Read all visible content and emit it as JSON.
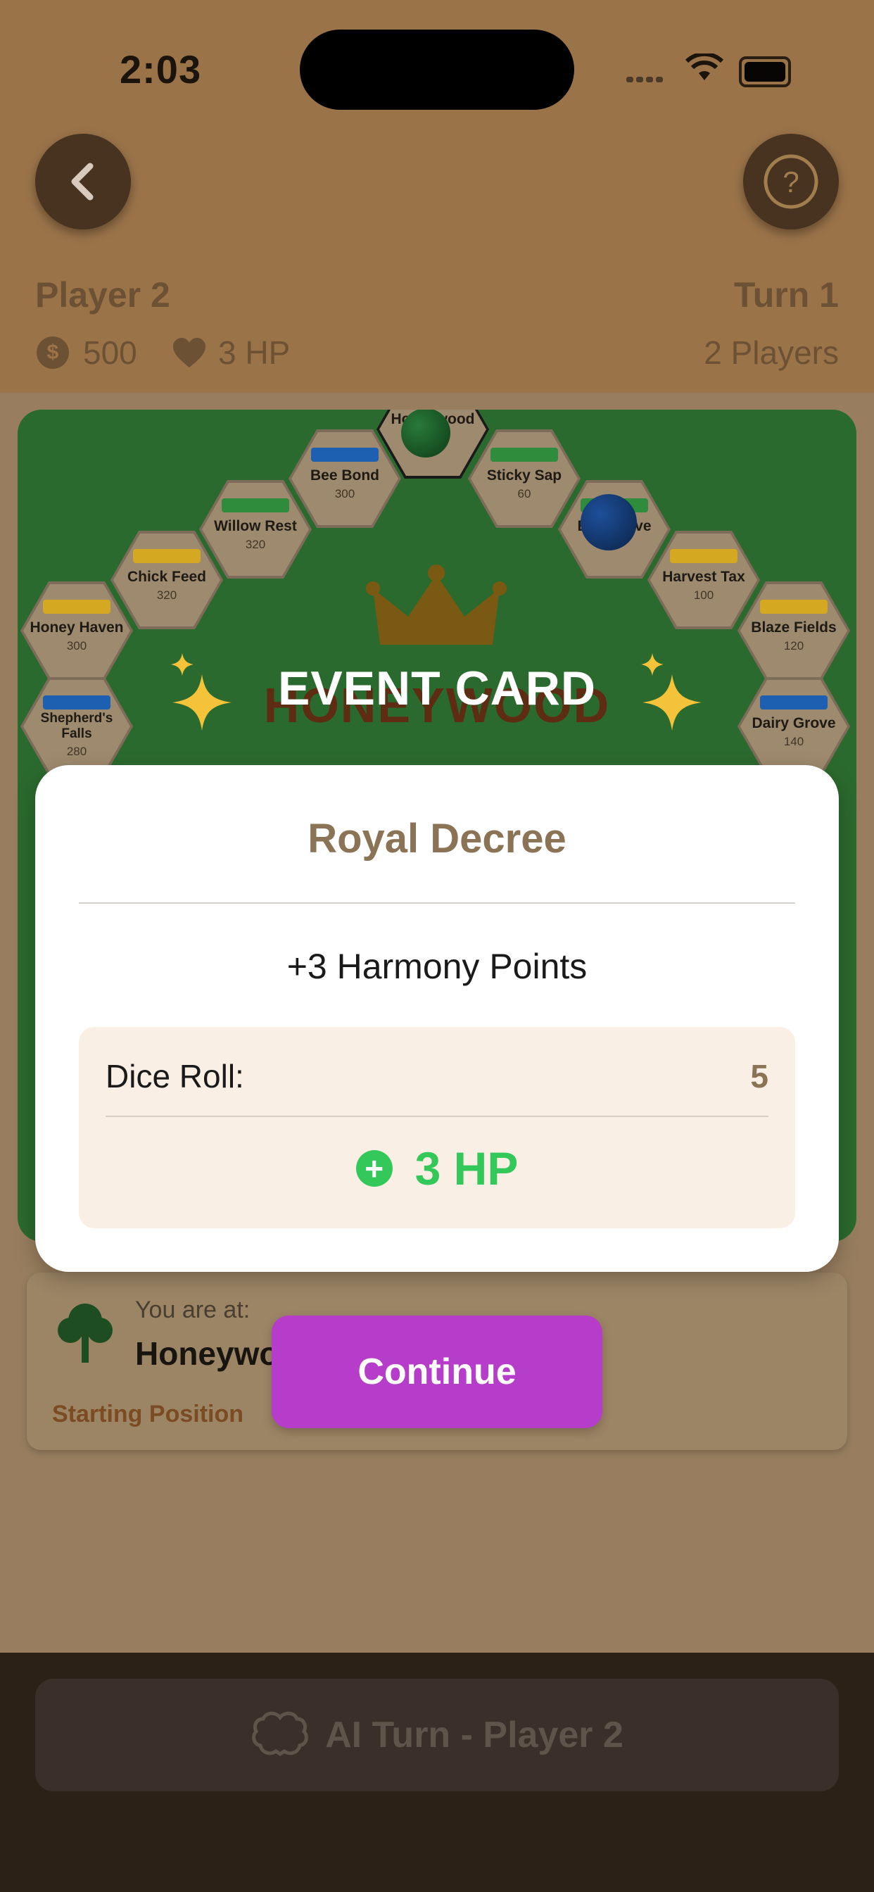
{
  "status_bar": {
    "time": "2:03"
  },
  "header": {
    "player_name": "Player 2",
    "turn": "Turn 1",
    "money": "500",
    "hp": "3 HP",
    "players": "2 Players"
  },
  "board": {
    "title": "HONEYWOOD",
    "top_tile": "Honeywood",
    "tiles": [
      {
        "name": "Bee Bond",
        "price": "300",
        "color": "#1d5fb0"
      },
      {
        "name": "Sticky Sap",
        "price": "60",
        "color": "#2f8c3c"
      },
      {
        "name": "Willow Rest",
        "price": "320",
        "color": "#2f8c3c"
      },
      {
        "name": "Elm Grove",
        "price": "",
        "color": "#2f8c3c"
      },
      {
        "name": "Chick Feed",
        "price": "320",
        "color": "#d4a820"
      },
      {
        "name": "Harvest Tax",
        "price": "100",
        "color": "#d4a820"
      },
      {
        "name": "Honey Haven",
        "price": "300",
        "color": "#d4a820"
      },
      {
        "name": "Blaze Fields",
        "price": "120",
        "color": "#d4a820"
      },
      {
        "name": "Shepherd's Falls",
        "price": "280",
        "color": "#1d5fb0"
      },
      {
        "name": "Dairy Grove",
        "price": "140",
        "color": "#1d5fb0"
      }
    ]
  },
  "location": {
    "label": "You are at:",
    "name": "Honeywood Start",
    "subtitle": "Starting Position"
  },
  "event": {
    "heading": "EVENT CARD",
    "card_name": "Royal Decree",
    "effect": "+3 Harmony Points",
    "dice_label": "Dice Roll:",
    "dice_value": "5",
    "result": "3 HP",
    "continue_label": "Continue"
  },
  "bottom": {
    "ai_button": "AI Turn - Player 2"
  },
  "colors": {
    "accent_purple": "#b53dc9",
    "positive_green": "#34c759",
    "title_brown": "#8b7355"
  }
}
